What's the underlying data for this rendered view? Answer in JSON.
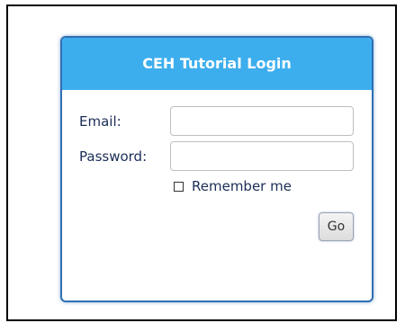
{
  "login": {
    "title": "CEH Tutorial Login",
    "email_label": "Email:",
    "email_value": "",
    "password_label": "Password:",
    "password_value": "",
    "remember_label": "Remember me",
    "remember_checked": false,
    "submit_label": "Go"
  },
  "colors": {
    "header_bg": "#3daeed",
    "header_text": "#ffffff",
    "box_border": "#2f6fb3",
    "label_text": "#1b2e57"
  }
}
